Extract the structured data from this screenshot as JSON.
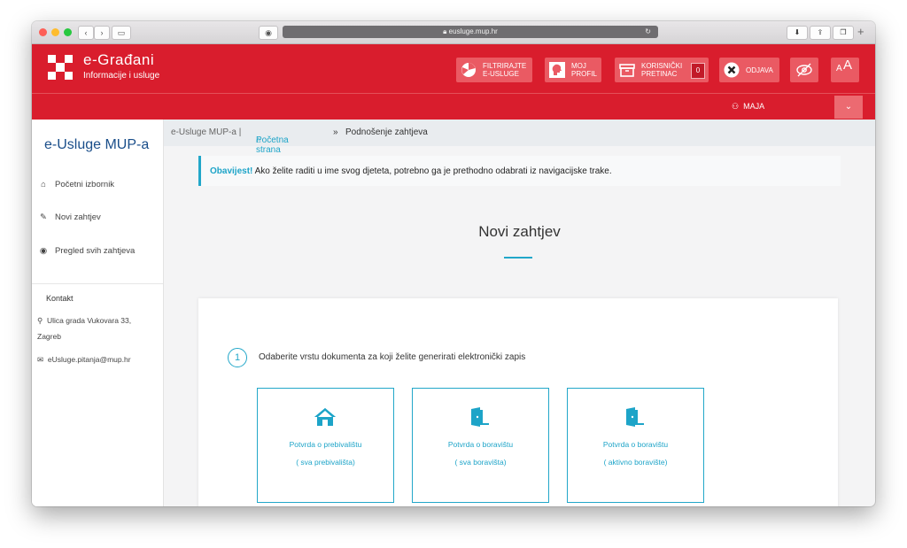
{
  "browser": {
    "url": "eusluge.mup.hr"
  },
  "header": {
    "brand_title": "e-Građani",
    "brand_subtitle": "Informacije i usluge",
    "buttons": {
      "filter_line1": "FILTRIRAJTE",
      "filter_line2": "E-USLUGE",
      "profile_line1": "MOJ",
      "profile_line2": "PROFIL",
      "inbox_line1": "KORISNIČKI",
      "inbox_line2": "PRETINAC",
      "inbox_count": "0",
      "logout": "ODJAVA",
      "font_size": "AA"
    },
    "user": "MAJA"
  },
  "sidebar": {
    "title": "e-Usluge MUP-a",
    "items": [
      {
        "label": "Početni izbornik",
        "icon": "home-icon"
      },
      {
        "label": "Novi zahtjev",
        "icon": "edit-icon"
      },
      {
        "label": "Pregled svih zahtjeva",
        "icon": "eye-icon"
      }
    ],
    "contact_heading": "Kontakt",
    "address_line1": "Ulica grada Vukovara 33,",
    "address_line2": "Zagreb",
    "email": "eUsluge.pitanja@mup.hr"
  },
  "breadcrumb": {
    "root": "e-Usluge MUP-a |",
    "home": "Početna strana",
    "separator": "»",
    "current": "Podnošenje zahtjeva"
  },
  "notice": {
    "label": "Obavijest!",
    "text": "Ako želite raditi u ime svog djeteta, potrebno ga je prethodno odabrati iz navigacijske trake."
  },
  "main": {
    "title": "Novi zahtjev",
    "step_number": "1",
    "step_text": "Odaberite vrstu dokumenta za koji želite generirati elektronički zapis",
    "options": [
      {
        "line1": "Potvrda o prebivalištu",
        "line2": "( sva prebivališta)",
        "icon": "house-icon"
      },
      {
        "line1": "Potvrda o boravištu",
        "line2": "( sva boravišta)",
        "icon": "door-icon"
      },
      {
        "line1": "Potvrda o boravištu",
        "line2": "( aktivno boravište)",
        "icon": "door-icon"
      }
    ]
  },
  "colors": {
    "brand_red": "#d91d2d",
    "accent_blue": "#22a7c9",
    "sidebar_title": "#1a4e8a"
  }
}
